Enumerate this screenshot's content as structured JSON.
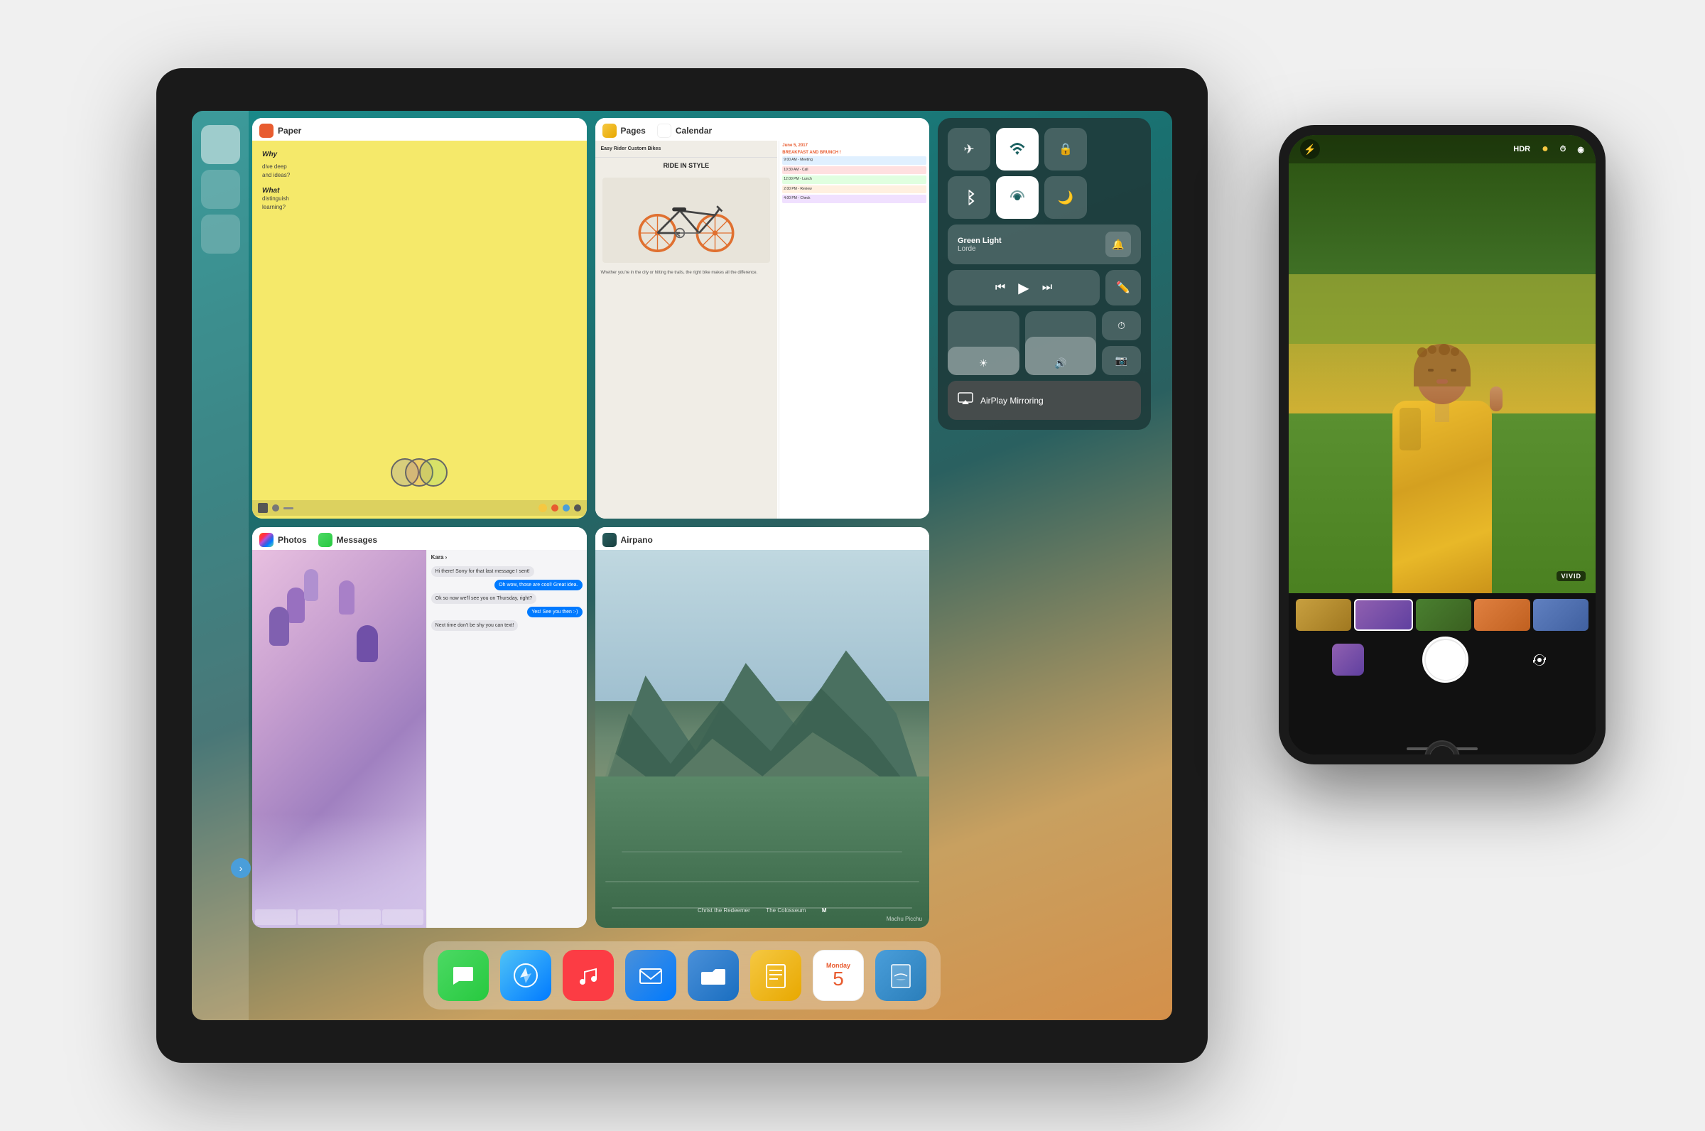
{
  "scene": {
    "background_color": "#eeeeee"
  },
  "ipad": {
    "apps_grid": [
      {
        "id": "paper",
        "name": "Paper",
        "icon_color": "#e85c30",
        "type": "sketch"
      },
      {
        "id": "pages-calendar",
        "names": [
          "Pages",
          "Calendar"
        ],
        "type": "dual"
      },
      {
        "id": "control-center",
        "type": "control-center"
      },
      {
        "id": "photos-messages",
        "names": [
          "Photos",
          "Messages"
        ],
        "type": "dual"
      },
      {
        "id": "airpano",
        "name": "Airpano",
        "type": "panorama"
      }
    ],
    "control_center": {
      "music_title": "Green Light",
      "music_artist": "Lorde",
      "airplay_label": "AirPlay Mirroring"
    },
    "dock": {
      "icons": [
        "Messages",
        "Safari",
        "Music",
        "Mail",
        "Files",
        "Pages",
        "Calendar",
        "Travel Book"
      ]
    }
  },
  "iphone": {
    "top_bar": {
      "flash_label": "⚡",
      "hdr_label": "HDR",
      "live_label": "●",
      "timer_label": "⏱",
      "filter_label": "◉"
    },
    "vivid_badge": "VIVID",
    "flip_icon": "↺"
  },
  "labels": {
    "airplay_mirroring": "AirPlay\nMirroring",
    "paper_app": "Paper",
    "pages_app": "Pages",
    "calendar_app": "Calendar",
    "photos_app": "Photos",
    "messages_app": "Messages",
    "airpano_app": "Airpano",
    "green_light": "Green Light",
    "lorde": "Lorde",
    "machu_picchu": "Machu Picchu",
    "ride_in_style": "RIDE IN STYLE",
    "monday": "Monday",
    "day_5": "5"
  }
}
